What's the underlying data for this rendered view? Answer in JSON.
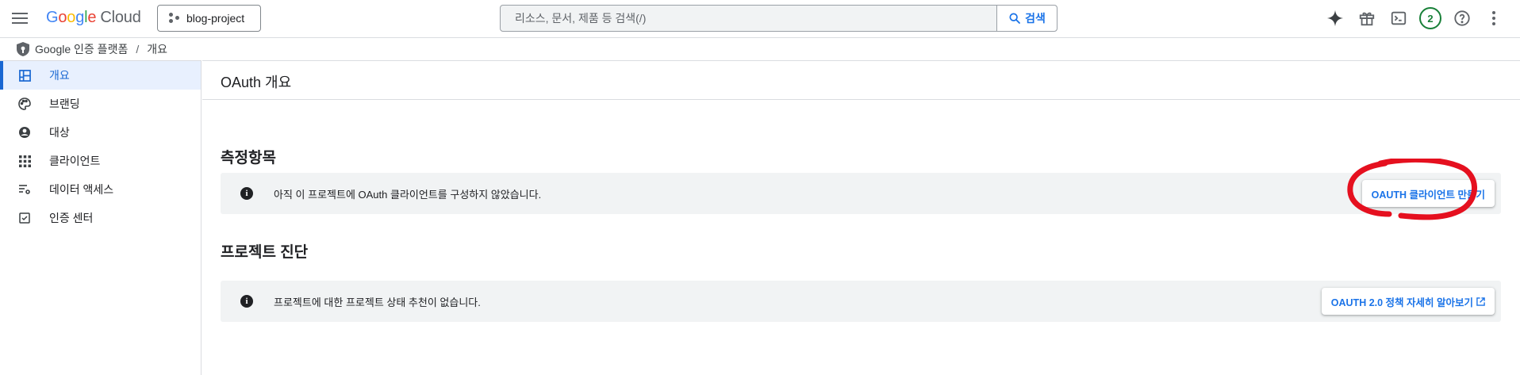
{
  "header": {
    "logo": {
      "letters": [
        "G",
        "o",
        "o",
        "g",
        "l",
        "e"
      ],
      "product": "Cloud"
    },
    "project": "blog-project",
    "search": {
      "placeholder": "리소스, 문서, 제품 등 검색(/)",
      "button": "검색"
    },
    "notification_count": "2",
    "icons": [
      "menu-icon",
      "gemini-spark-icon",
      "gift-icon",
      "cloud-shell-icon",
      "help-icon",
      "more-vert-icon"
    ]
  },
  "breadcrumb": {
    "product": "Google 인증 플랫폼",
    "separator": "/",
    "current": "개요"
  },
  "sidebar": {
    "items": [
      {
        "label": "개요",
        "icon": "dashboard-icon",
        "active": true
      },
      {
        "label": "브랜딩",
        "icon": "palette-icon",
        "active": false
      },
      {
        "label": "대상",
        "icon": "account-circle-icon",
        "active": false
      },
      {
        "label": "클라이언트",
        "icon": "apps-grid-icon",
        "active": false
      },
      {
        "label": "데이터 액세스",
        "icon": "data-access-icon",
        "active": false
      },
      {
        "label": "인증 센터",
        "icon": "checkbox-icon",
        "active": false
      }
    ]
  },
  "main": {
    "title": "OAuth 개요",
    "metrics": {
      "title": "측정항목",
      "message": "아직 이 프로젝트에 OAuth 클라이언트를 구성하지 않았습니다.",
      "button": "OAUTH 클라이언트 만들기"
    },
    "diagnostics": {
      "title": "프로젝트 진단",
      "message": "프로젝트에 대한 프로젝트 상태 추천이 없습니다.",
      "button": "OAUTH 2.0 정책 자세히 알아보기"
    }
  },
  "colors": {
    "accent": "#1a73e8",
    "active_nav_bg": "#e8f0fe",
    "panel_bg": "#f1f3f4",
    "annotation": "#e5101f",
    "badge": "#188038"
  }
}
